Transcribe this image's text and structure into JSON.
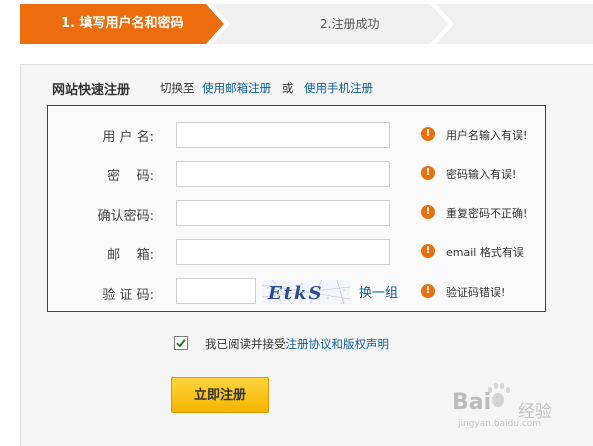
{
  "steps": {
    "step1": "1. 填写用户名和密码",
    "step2": "2.注册成功",
    "active_color": "#ec6c0e"
  },
  "quick_register": {
    "title": "网站快速注册",
    "switch_text": "切换至",
    "email_link": "使用邮箱注册",
    "or": "或",
    "phone_link": "使用手机注册"
  },
  "form": {
    "fields": [
      {
        "label": "用 户 名:",
        "value": "",
        "error": "用户名输入有误!"
      },
      {
        "label": "密    码:",
        "value": "",
        "error": "密码输入有误!"
      },
      {
        "label": "确认密码:",
        "value": "",
        "error": "重复密码不正确!"
      },
      {
        "label": "邮    箱:",
        "value": "",
        "error": "email 格式有误"
      },
      {
        "label": "验 证 码:",
        "value": "",
        "error": "验证码错误!"
      }
    ],
    "captcha_text": "EtkS",
    "refresh": "换一组",
    "warn_icon": "warning-icon",
    "error_border_color": "#d7000f"
  },
  "agree": {
    "checked": true,
    "prefix": "我已阅读并接受",
    "link": "注册协议和版权声明"
  },
  "submit_label": "立即注册",
  "watermark": {
    "logo": "Bai",
    "suffix": "经验",
    "url": "jingyan.baidu.com"
  }
}
